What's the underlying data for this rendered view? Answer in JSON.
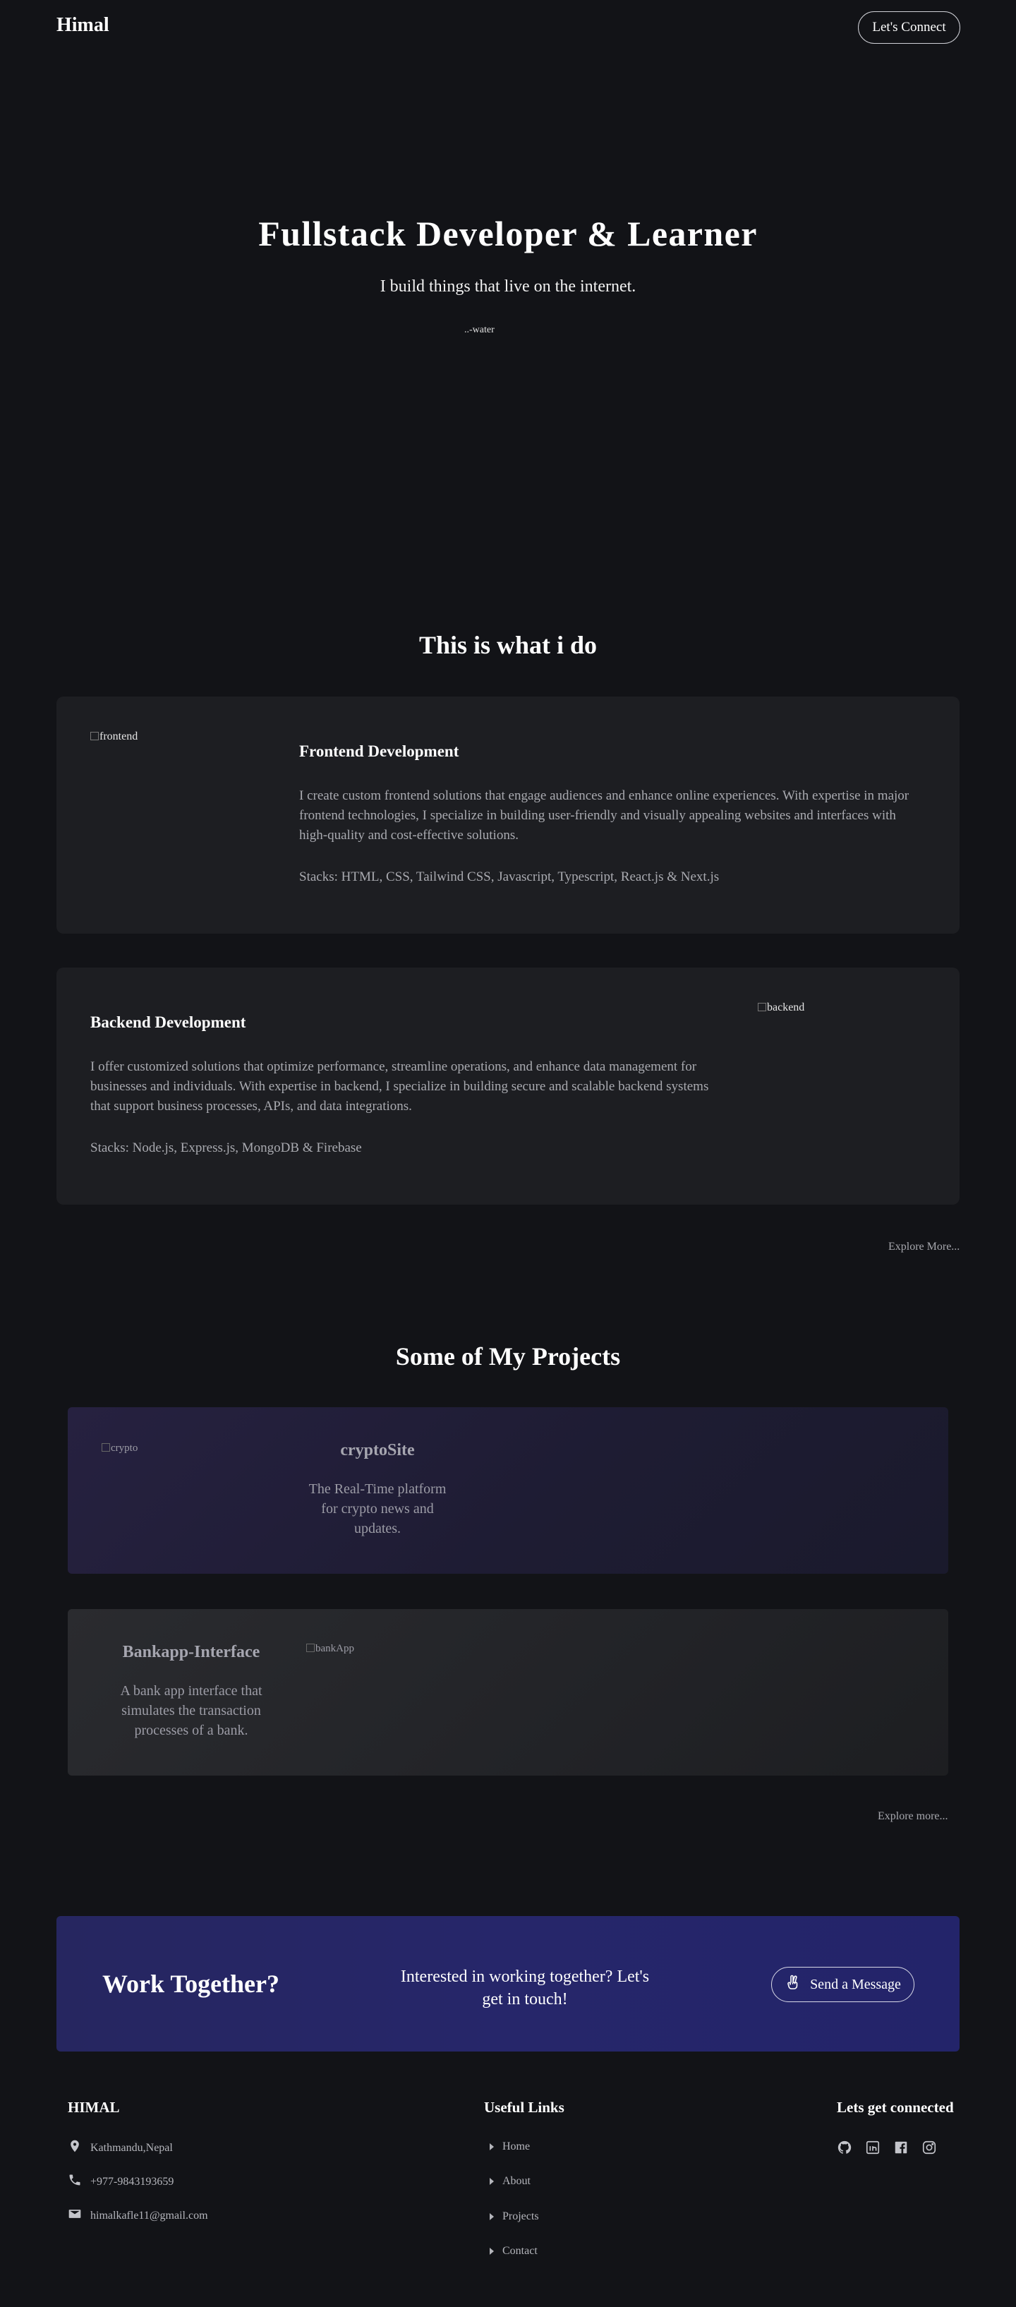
{
  "nav": {
    "logo": "Himal",
    "connect_label": "Let's Connect"
  },
  "hero": {
    "title": "Fullstack Developer & Learner",
    "subtitle": "I build things that live on the internet.",
    "image_alt": "..-water"
  },
  "services": {
    "title": "This is what i do",
    "items": [
      {
        "image_alt": "frontend",
        "title": "Frontend Development",
        "description": "I create custom frontend solutions that engage audiences and enhance online experiences. With expertise in major frontend technologies, I specialize in building user-friendly and visually appealing websites and interfaces with high-quality and cost-effective solutions.",
        "stacks": "Stacks: HTML, CSS, Tailwind CSS, Javascript, Typescript, React.js & Next.js"
      },
      {
        "image_alt": "backend",
        "title": "Backend Development",
        "description": "I offer customized solutions that optimize performance, streamline operations, and enhance data management for businesses and individuals. With expertise in backend, I specialize in building secure and scalable backend systems that support business processes, APIs, and data integrations.",
        "stacks": "Stacks: Node.js, Express.js, MongoDB & Firebase"
      }
    ],
    "explore_label": "Explore More..."
  },
  "projects": {
    "title": "Some of My Projects",
    "items": [
      {
        "image_alt": "crypto",
        "title": "cryptoSite",
        "description": "The Real-Time platform for crypto news and updates."
      },
      {
        "image_alt": "bankApp",
        "title": "Bankapp-Interface",
        "description": "A bank app interface that simulates the transaction processes of a bank."
      }
    ],
    "explore_label": "Explore more..."
  },
  "cta": {
    "title": "Work Together?",
    "text": "Interested in working together? Let's get in touch!",
    "button_label": "Send a Message",
    "icon": "hand-peace-icon"
  },
  "footer": {
    "brand": "HIMAL",
    "contact": [
      {
        "icon": "location-icon",
        "text": "Kathmandu,Nepal"
      },
      {
        "icon": "phone-icon",
        "text": "+977-9843193659"
      },
      {
        "icon": "mail-icon",
        "text": "himalkafle11@gmail.com"
      }
    ],
    "links_title": "Useful Links",
    "links": [
      "Home",
      "About",
      "Projects",
      "Contact"
    ],
    "social_title": "Lets get connected",
    "social": [
      "github-icon",
      "linkedin-icon",
      "facebook-icon",
      "instagram-icon"
    ]
  },
  "colors": {
    "background": "#121317",
    "card": "#1d1e22",
    "cta": "#26266a",
    "muted_text": "#a9aab0"
  }
}
